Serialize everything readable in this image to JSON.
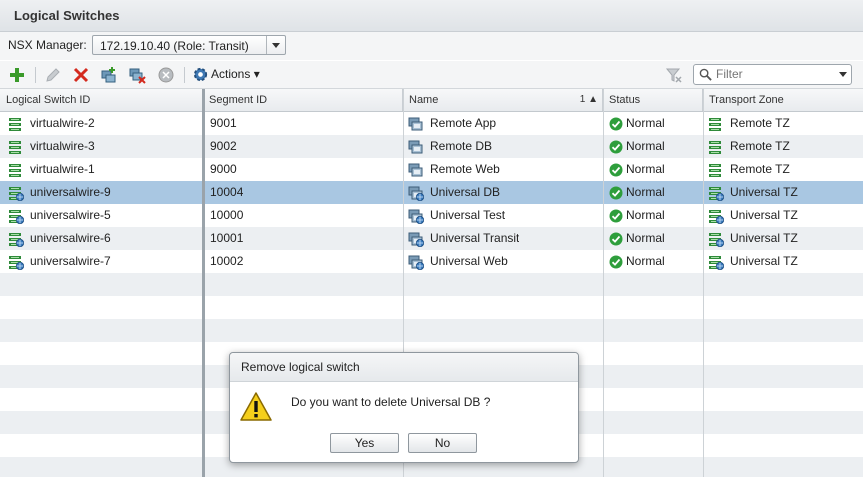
{
  "panel": {
    "title": "Logical Switches"
  },
  "manager": {
    "label": "NSX Manager:",
    "selected": "172.19.10.40 (Role: Transit)"
  },
  "toolbar": {
    "actions_label": "Actions",
    "filter_placeholder": "Filter"
  },
  "columns": {
    "logical_switch_id": "Logical Switch ID",
    "segment_id": "Segment ID",
    "name": "Name",
    "sort_indicator": "1 ▲",
    "status": "Status",
    "transport_zone": "Transport Zone"
  },
  "rows": [
    {
      "id": "virtualwire-2",
      "segment": "9001",
      "name": "Remote App",
      "status": "Normal",
      "zone": "Remote TZ",
      "universal": false,
      "selected": false
    },
    {
      "id": "virtualwire-3",
      "segment": "9002",
      "name": "Remote DB",
      "status": "Normal",
      "zone": "Remote TZ",
      "universal": false,
      "selected": false
    },
    {
      "id": "virtualwire-1",
      "segment": "9000",
      "name": "Remote Web",
      "status": "Normal",
      "zone": "Remote TZ",
      "universal": false,
      "selected": false
    },
    {
      "id": "universalwire-9",
      "segment": "10004",
      "name": "Universal DB",
      "status": "Normal",
      "zone": "Universal TZ",
      "universal": true,
      "selected": true
    },
    {
      "id": "universalwire-5",
      "segment": "10000",
      "name": "Universal Test",
      "status": "Normal",
      "zone": "Universal TZ",
      "universal": true,
      "selected": false
    },
    {
      "id": "universalwire-6",
      "segment": "10001",
      "name": "Universal Transit",
      "status": "Normal",
      "zone": "Universal TZ",
      "universal": true,
      "selected": false
    },
    {
      "id": "universalwire-7",
      "segment": "10002",
      "name": "Universal Web",
      "status": "Normal",
      "zone": "Universal TZ",
      "universal": true,
      "selected": false
    }
  ],
  "dialog": {
    "title": "Remove logical switch",
    "message": "Do you want to delete Universal DB ?",
    "yes_label": "Yes",
    "no_label": "No"
  },
  "colors": {
    "selection": "#a9c7e2",
    "status_ok": "#2e9e3c",
    "delete_red": "#d42a1e",
    "add_green": "#3a9a2a"
  },
  "icons": {
    "add": "plus-icon",
    "edit": "pencil-icon",
    "delete": "x-icon",
    "add_vm": "add-vm-icon",
    "remove_vm": "remove-vm-icon",
    "disabled": "circle-icon",
    "actions": "gear-icon",
    "clear_filter": "funnel-clear-icon",
    "search": "search-icon",
    "switch": "logical-switch-icon",
    "vm_group": "vm-group-icon",
    "status": "check-circle-icon",
    "warning": "warning-triangle-icon"
  }
}
